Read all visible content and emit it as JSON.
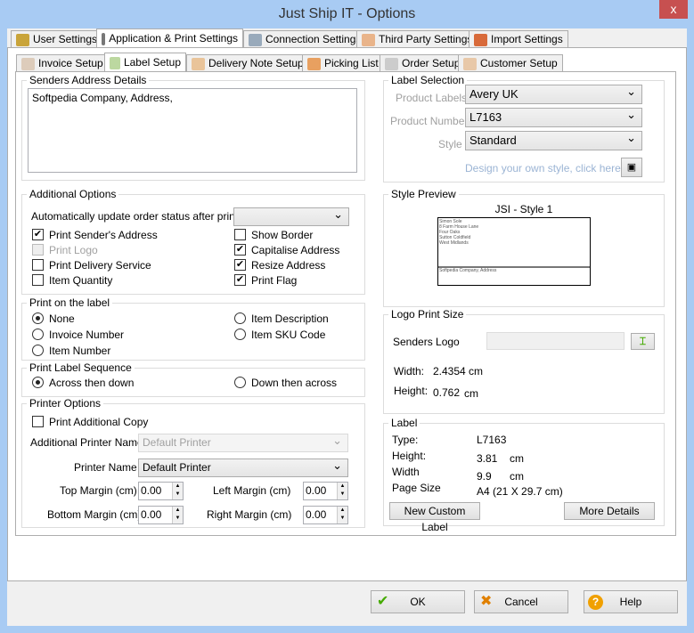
{
  "window": {
    "title": "Just Ship IT - Options",
    "close": "x"
  },
  "main_tabs": [
    "User Settings",
    "Application & Print Settings",
    "Connection Settings",
    "Third Party Settings",
    "Import Settings"
  ],
  "sub_tabs": [
    "Invoice Setup",
    "Label Setup",
    "Delivery Note Setup",
    "Picking List",
    "Order Setup",
    "Customer Setup"
  ],
  "senders": {
    "title": "Senders Address Details",
    "value": "Softpedia Company, Address,"
  },
  "additional": {
    "title": "Additional Options",
    "auto_update_label": "Automatically update order status after print to:",
    "auto_update_value": "",
    "checks": [
      {
        "label": "Print Sender's Address",
        "checked": true,
        "disabled": false
      },
      {
        "label": "Print Logo",
        "checked": false,
        "disabled": true
      },
      {
        "label": "Print Delivery Service",
        "checked": false,
        "disabled": false
      },
      {
        "label": "Item Quantity",
        "checked": false,
        "disabled": false
      },
      {
        "label": "Show Border",
        "checked": false,
        "disabled": false
      },
      {
        "label": "Capitalise Address",
        "checked": true,
        "disabled": false
      },
      {
        "label": "Resize Address",
        "checked": true,
        "disabled": false
      },
      {
        "label": "Print Flag",
        "checked": true,
        "disabled": false
      }
    ]
  },
  "print_on": {
    "title": "Print on the label",
    "options": [
      "None",
      "Invoice Number",
      "Item Number",
      "Item Description",
      "Item SKU Code"
    ],
    "selected": "None"
  },
  "sequence": {
    "title": "Print Label Sequence",
    "options": [
      "Across then down",
      "Down then across"
    ],
    "selected": "Across then down"
  },
  "printer": {
    "title": "Printer Options",
    "additional_copy": "Print Additional Copy",
    "additional_name_label": "Additional Printer Name",
    "additional_name_value": "Default Printer",
    "name_label": "Printer Name",
    "name_value": "Default Printer",
    "top_label": "Top Margin (cm)",
    "top": "0.00",
    "left_label": "Left Margin (cm)",
    "left": "0.00",
    "bottom_label": "Bottom Margin (cm)",
    "bottom": "0.00",
    "right_label": "Right Margin (cm)",
    "right": "0.00"
  },
  "label_selection": {
    "title": "Label Selection",
    "product_labels_label": "Product Labels",
    "product_labels": "Avery UK",
    "product_number_label": "Product Number",
    "product_number": "L7163",
    "style_label": "Style",
    "style": "Standard",
    "design_link": "Design your own style, click here >"
  },
  "preview": {
    "title": "Style Preview",
    "style_name": "JSI - Style 1",
    "lines": [
      "Simon Sole",
      "8 Farm House Lane",
      "Four Oaks",
      "Sutton Coldfield",
      "West Midlands"
    ],
    "footer": "Softpedia Company, Address"
  },
  "logo": {
    "title": "Logo Print Size",
    "senders_logo": "Senders Logo",
    "width_label": "Width:",
    "width": "2.4354 cm",
    "height_label": "Height:",
    "height": "0.762",
    "height_unit": "cm"
  },
  "label": {
    "title": "Label",
    "type_label": "Type:",
    "type": "L7163",
    "height_label": "Height:",
    "height": "3.81",
    "height_unit": "cm",
    "width_label": "Width",
    "width": "9.9",
    "width_unit": "cm",
    "page_label": "Page Size",
    "page": "A4 (21 X 29.7 cm)",
    "new_custom": "New Custom Label",
    "more": "More Details"
  },
  "footer": {
    "ok": "OK",
    "cancel": "Cancel",
    "help": "Help"
  }
}
